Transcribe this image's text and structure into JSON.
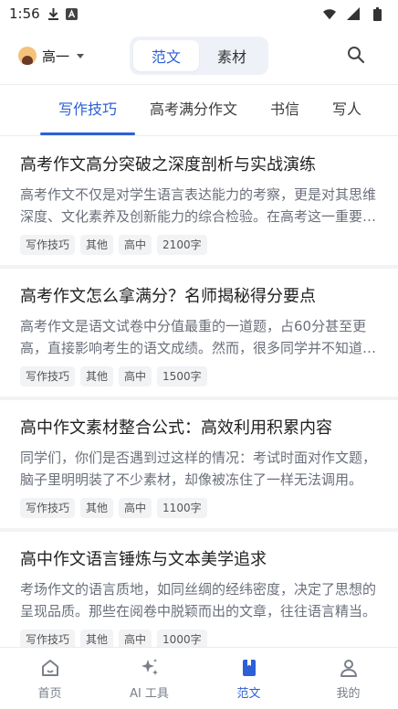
{
  "status_bar": {
    "time": "1:56",
    "icons": [
      "download-icon",
      "a-notification-icon",
      "wifi-icon",
      "signal-icon",
      "battery-icon"
    ]
  },
  "header": {
    "grade": "高一",
    "segments": [
      {
        "label": "范文",
        "active": true
      },
      {
        "label": "素材",
        "active": false
      }
    ]
  },
  "tabs": [
    {
      "label": "写作技巧",
      "active": true
    },
    {
      "label": "高考满分作文",
      "active": false
    },
    {
      "label": "书信",
      "active": false
    },
    {
      "label": "写人",
      "active": false
    }
  ],
  "articles": [
    {
      "title": "高考作文高分突破之深度剖析与实战演练",
      "excerpt": "高考作文不仅是对学生语言表达能力的考察，更是对其思维深度、文化素养及创新能力的综合检验。在高考这一重要时刻，如何写出一篇高分作文？",
      "tags": [
        "写作技巧",
        "其他",
        "高中",
        "2100字"
      ]
    },
    {
      "title": "高考作文怎么拿满分？名师揭秘得分要点",
      "excerpt": "高考作文是语文试卷中分值最重的一道题，占60分甚至更高，直接影响考生的语文成绩。然而，很多同学并不知道作文的得分要点。",
      "tags": [
        "写作技巧",
        "其他",
        "高中",
        "1500字"
      ]
    },
    {
      "title": "高中作文素材整合公式：高效利用积累内容",
      "excerpt": "同学们，你们是否遇到过这样的情况：考试时面对作文题，脑子里明明装了不少素材，却像被冻住了一样无法调用。",
      "tags": [
        "写作技巧",
        "其他",
        "高中",
        "1100字"
      ]
    },
    {
      "title": "高中作文语言锤炼与文本美学追求",
      "excerpt": "考场作文的语言质地，如同丝绸的经纬密度，决定了思想的呈现品质。那些在阅卷中脱颖而出的文章，往往语言精当。",
      "tags": [
        "写作技巧",
        "其他",
        "高中",
        "1000字"
      ]
    }
  ],
  "bottom_nav": [
    {
      "label": "首页",
      "icon": "home-icon",
      "active": false
    },
    {
      "label": "AI 工具",
      "icon": "sparkle-icon",
      "active": false
    },
    {
      "label": "范文",
      "icon": "book-icon",
      "active": true
    },
    {
      "label": "我的",
      "icon": "person-icon",
      "active": false
    }
  ],
  "colors": {
    "accent": "#2d5fd6",
    "muted": "#6a6f7a"
  }
}
